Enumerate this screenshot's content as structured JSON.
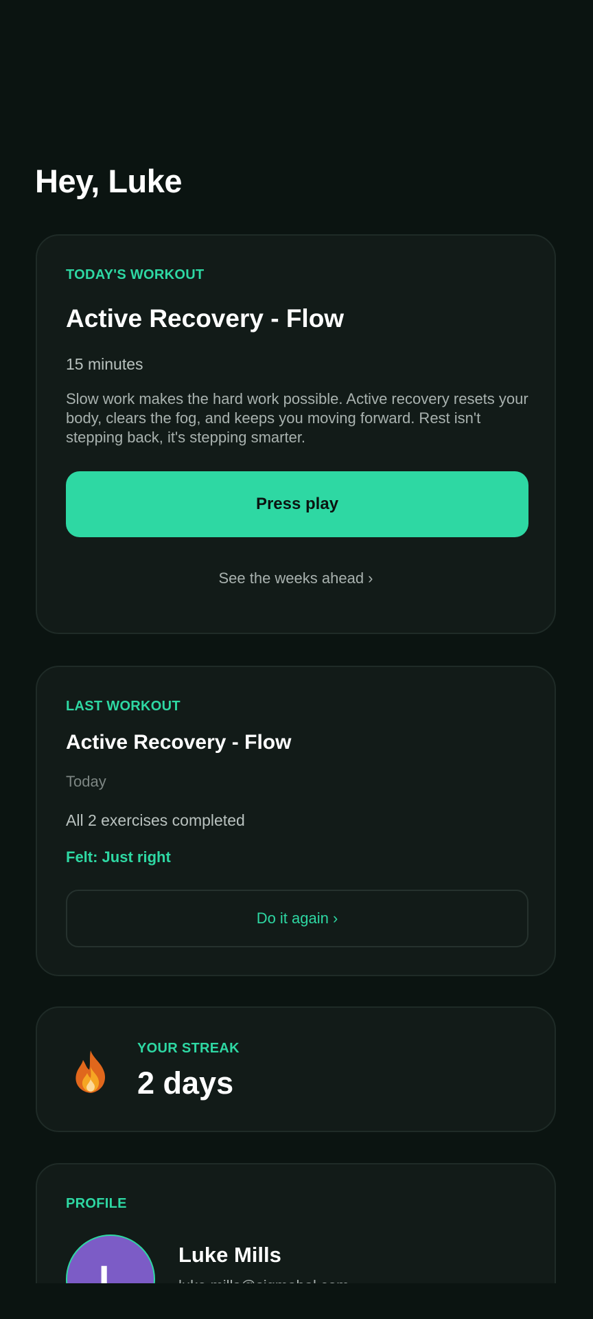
{
  "greeting": "Hey, Luke",
  "today": {
    "eyebrow": "TODAY'S WORKOUT",
    "title": "Active Recovery - Flow",
    "duration": "15 minutes",
    "description": "Slow work makes the hard work possible. Active recovery resets your body, clears the fog, and keeps you moving forward. Rest isn't stepping back, it's stepping smarter.",
    "play_label": "Press play",
    "weeks_link": "See the weeks ahead ›"
  },
  "last": {
    "eyebrow": "LAST WORKOUT",
    "title": "Active Recovery - Flow",
    "date": "Today",
    "completed": "All 2 exercises completed",
    "felt": "Felt: Just right",
    "again_label": "Do it again ›"
  },
  "streak": {
    "eyebrow": "YOUR STREAK",
    "value": "2 days",
    "icon": "fire-icon"
  },
  "profile": {
    "eyebrow": "PROFILE",
    "initial": "L",
    "name": "Luke Mills",
    "email": "luke.mills@sigmabal.com"
  },
  "colors": {
    "background": "#0b1411",
    "card": "#121b18",
    "accent": "#2ed8a3",
    "avatar": "#7c5cc6"
  }
}
